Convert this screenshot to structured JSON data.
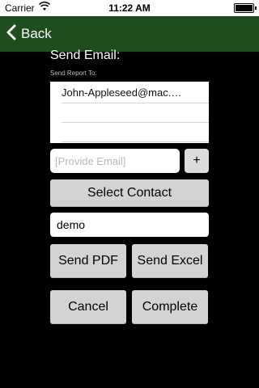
{
  "status_bar": {
    "carrier": "Carrier",
    "time": "11:22 AM"
  },
  "nav": {
    "back_label": "Back",
    "bar_color": "#1e4d1e"
  },
  "email_section": {
    "title": "Send Email:",
    "subtitle": "Send Report To:",
    "recipients": [
      "John-Appleseed@mac.…",
      "",
      ""
    ],
    "email_placeholder": "[Provide Email]",
    "add_label": "+"
  },
  "select_contact_label": "Select Contact",
  "name_value": "demo",
  "actions": {
    "send_pdf": "Send PDF",
    "send_excel": "Send Excel",
    "cancel": "Cancel",
    "complete": "Complete"
  }
}
